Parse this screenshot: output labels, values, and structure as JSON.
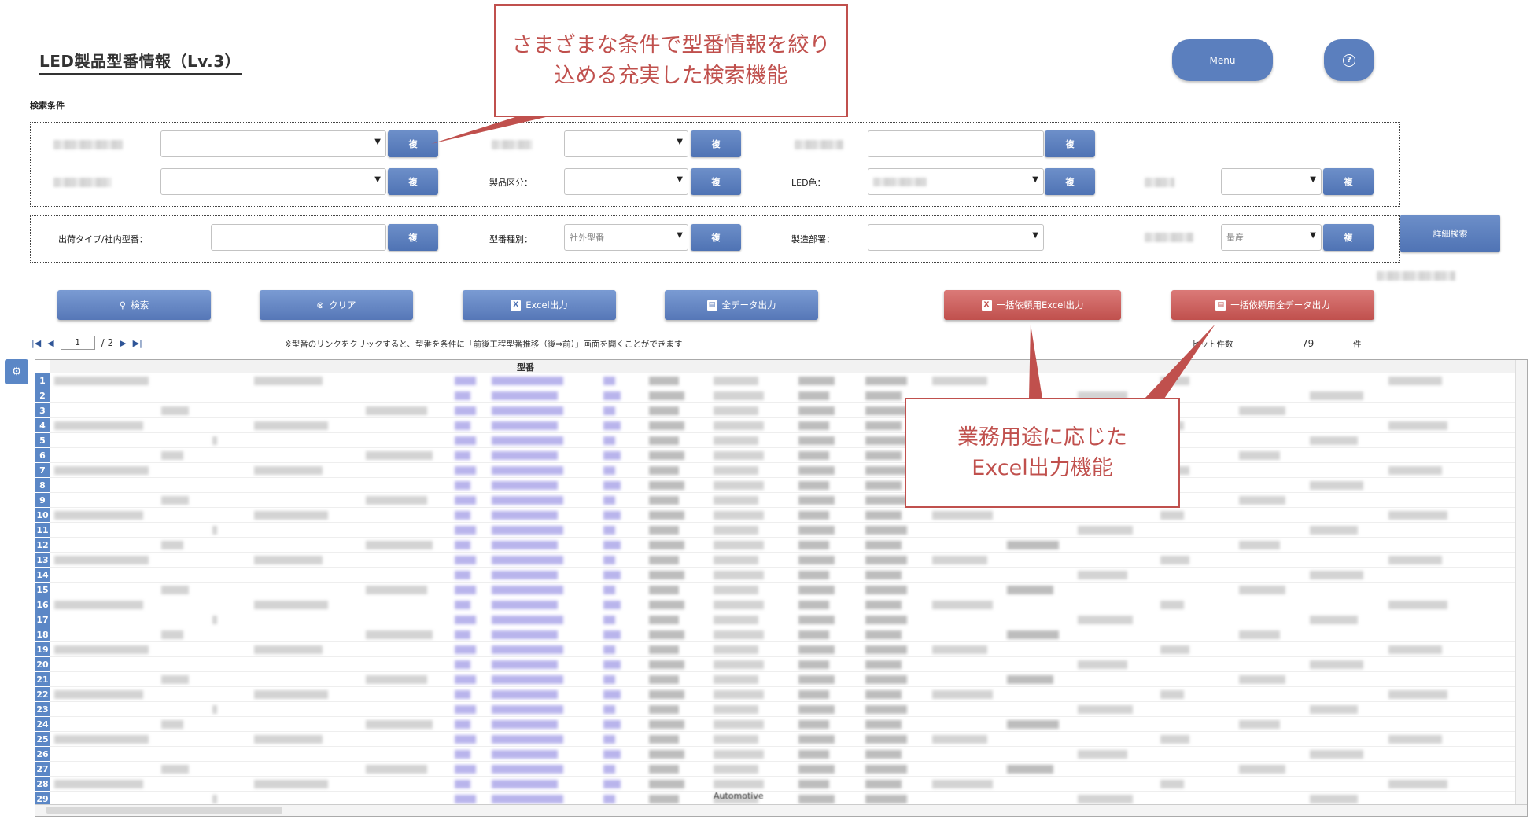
{
  "header": {
    "title": "LED製品型番情報（Lv.3）",
    "menu_label": "Menu",
    "help_glyph": "?"
  },
  "search": {
    "section_label": "検索条件",
    "copy_label": "複",
    "filters": {
      "product_category_label": "製品区分：",
      "led_color_label": "LED色：",
      "shipping_type_label": "出荷タイプ/社内型番：",
      "model_type_label": "型番種別：",
      "model_type_value": "社外型番",
      "manufacturing_dept_label": "製造部署：",
      "production_value": "量産"
    },
    "detail_search_label": "詳細検索"
  },
  "actions": {
    "search_label": "検索",
    "clear_label": "クリア",
    "excel_label": "Excel出力",
    "all_data_label": "全データ出力",
    "bulk_excel_label": "一括依頼用Excel出力",
    "bulk_all_label": "一括依頼用全データ出力"
  },
  "pager": {
    "current_page": "1",
    "total_pages": "/ 2",
    "note": "※型番のリンクをクリックすると、型番を条件に「前後工程型番推移（後⇒前）」画面を開くことができます",
    "hit_label": "ヒット件数",
    "hit_count": "79",
    "hit_unit": "件"
  },
  "grid": {
    "column_header_model": "型番",
    "row_numbers": [
      "1",
      "2",
      "3",
      "4",
      "5",
      "6",
      "7",
      "8",
      "9",
      "10",
      "11",
      "12",
      "13",
      "14",
      "15",
      "16",
      "17",
      "18",
      "19",
      "20",
      "21",
      "22",
      "23",
      "24",
      "25",
      "26",
      "27",
      "28",
      "29"
    ],
    "visible_cell_text": "Automotive"
  },
  "callouts": {
    "search_feature": "さまざまな条件で型番情報を絞り込める充実した検索機能",
    "excel_feature_line1": "業務用途に応じた",
    "excel_feature_line2": "Excel出力機能"
  },
  "colors": {
    "button_blue": "#5b7fbe",
    "button_red": "#c0504d",
    "callout_red": "#c0504d",
    "row_header_blue": "#5b87c6"
  }
}
